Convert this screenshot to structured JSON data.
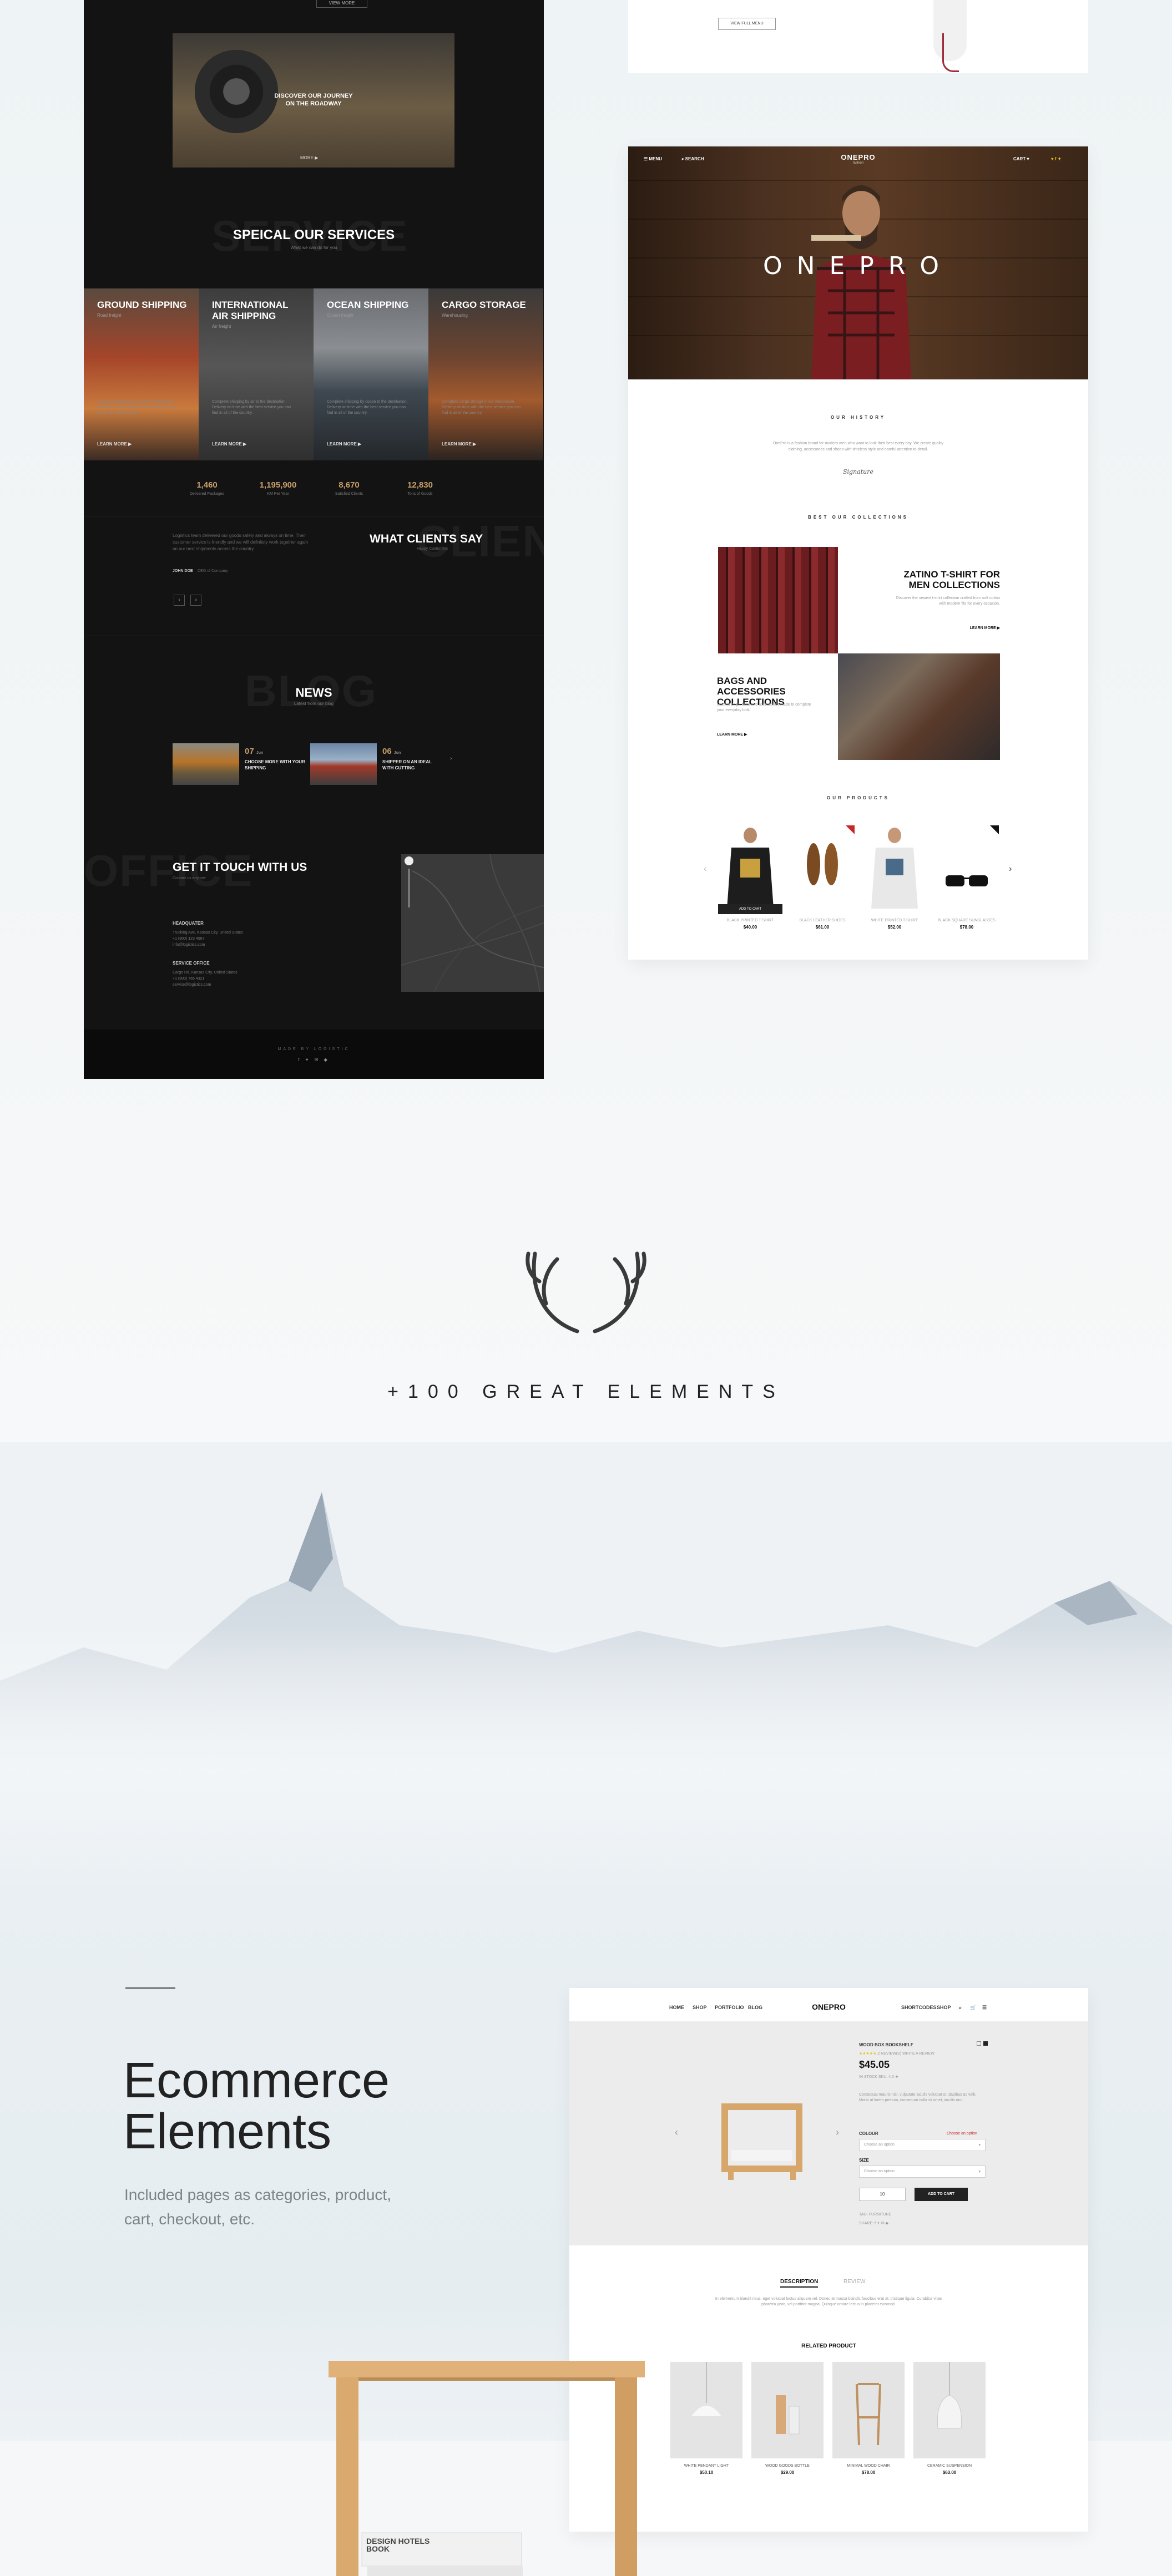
{
  "dark_page": {
    "top_button": "VIEW MORE",
    "hero": {
      "title": "DISCOVER OUR JOURNEY\nON THE ROADWAY",
      "more": "MORE ▶"
    },
    "services": {
      "ghost": "SERVICE",
      "title": "SPEICAL OUR SERVICES",
      "subtitle": "What we can do for you",
      "items": [
        {
          "title": "GROUND SHIPPING",
          "sub": "Road freight",
          "text": "Complete shipping by land to the destination. Delivery on time with the best service you can find in all of the country.",
          "more": "LEARN MORE ▶"
        },
        {
          "title": "INTERNATIONAL AIR SHIPPING",
          "sub": "Air freight",
          "text": "Complete shipping by air to the destination. Delivery on time with the best service you can find in all of the country.",
          "more": "LEARN MORE ▶"
        },
        {
          "title": "OCEAN SHIPPING",
          "sub": "Ocean freight",
          "text": "Complete shipping by ocean to the destination. Delivery on time with the best service you can find in all of the country.",
          "more": "LEARN MORE ▶"
        },
        {
          "title": "CARGO STORAGE",
          "sub": "Warehousing",
          "text": "Complete cargo storage in our warehouse. Delivery on time with the best service you can find in all of the country.",
          "more": "LEARN MORE ▶"
        }
      ]
    },
    "stats": [
      {
        "num": "1,460",
        "label": "Delivered Packages"
      },
      {
        "num": "1,195,900",
        "label": "KM Per Year"
      },
      {
        "num": "8,670",
        "label": "Satisfied Clients"
      },
      {
        "num": "12,830",
        "label": "Tons of Goods"
      }
    ],
    "clients": {
      "ghost": "CLIENT",
      "title": "WHAT CLIENTS SAY",
      "subtitle": "Happy Customers",
      "quote": "Logistics team delivered our goods safely and always on time. Their customer service is friendly and we will definitely work together again on our next shipments across the country.",
      "author": "JOHN DOE",
      "role": "CEO of Company",
      "prev": "‹",
      "next": "›"
    },
    "news": {
      "ghost": "BLOG",
      "title": "NEWS",
      "subtitle": "Latest from our blog",
      "items": [
        {
          "day": "07",
          "month": "Jun",
          "title": "CHOOSE MORE WITH YOUR SHIPPING"
        },
        {
          "day": "06",
          "month": "Jun",
          "title": "SHIPPER ON AN IDEAL WITH CUTTING"
        }
      ],
      "next": "›"
    },
    "contact": {
      "ghost": "OFFICE",
      "title": "GET IT TOUCH WITH US",
      "subtitle": "Contact us anytime",
      "hq_label": "HEADQUATER",
      "hq_text": "Trucking Ave, Kansas City, United States\n+1 (800) 123 4567\ninfo@logistics.com",
      "office_label": "SERVICE OFFICE",
      "office_text": "Cargo Rd, Kansas City, United States\n+1 (800) 765 4321\nservice@logistics.com"
    },
    "footer": {
      "made_by": "MADE BY LOGISTIC",
      "social": "f ✦ ✉ ◆"
    }
  },
  "vcard_top": {
    "button": "VIEW FULL MENU"
  },
  "onepro": {
    "nav_left": [
      "☰ MENU",
      "⌕ SEARCH"
    ],
    "logo": "ONEPRO",
    "logo_sub": "fashion",
    "nav_right": [
      "CART ▾",
      "♥  f  ✦"
    ],
    "hero_title": "ONEPRO",
    "history_h": "OUR HISTORY",
    "history_text": "OnePro is a fashion brand for modern men who want to look their best every day. We create quality clothing, accessories and shoes with timeless style and careful attention to detail.",
    "signature": "Signature",
    "collections_h": "BEST OUR COLLECTIONS",
    "col1_title": "ZATINO T-SHIRT FOR MEN COLLECTIONS",
    "col1_text": "Discover the newest t-shirt collection crafted from soft cotton with modern fits for every occasion.",
    "col1_link": "LEARN MORE ▶",
    "col2_title": "BAGS AND ACCESSORIES COLLECTIONS",
    "col2_text": "Leather bags, belts and accessories made to complete your everyday look.",
    "col2_link": "LEARN MORE ▶",
    "products_h": "OUR PRODUCTS",
    "add_to_cart": "ADD TO CART",
    "products": [
      {
        "name": "BLACK PRINTED T-SHIRT",
        "price": "$40.00"
      },
      {
        "name": "BLACK LEATHER SHOES",
        "price": "$61.00"
      },
      {
        "name": "WHITE PRINTED T-SHIRT",
        "price": "$52.00"
      },
      {
        "name": "BLACK SQUARE SUNGLASSES",
        "price": "$78.00"
      }
    ]
  },
  "tagline": "+100 GREAT ELEMENTS",
  "ecommerce": {
    "title_line1": "Ecommerce",
    "title_line2": "Elements",
    "subtitle": "Included pages as categories, product,\ncart, checkout, etc."
  },
  "shop": {
    "nav_left": [
      "HOME",
      "SHOP",
      "PORTFOLIO",
      "BLOG"
    ],
    "logo": "ONEPRO",
    "nav_right": [
      "SHORTCODES",
      "SHOP",
      "⌕",
      "🛒",
      "☰"
    ],
    "product_name": "WOOD BOX BOOKSHELF",
    "reviews": "2 REVIEW(S)   WRITE A REVIEW",
    "price": "$45.05",
    "availability": "IN STOCK   SKU: 4.0 ★",
    "description": "Consequat mauris nisl, vulputate iaculis volutpat ut, dapibus ac velit. Morbi ut lorem pretium, consequat nulla sit amet, iaculis orci.",
    "colour_label": "COLOUR",
    "colour_hint": "Choose an option",
    "colour_value": "Choose an option",
    "size_label": "SIZE",
    "size_value": "Choose an option",
    "qty": "10",
    "add_to_cart": "ADD TO CART",
    "tags": "TAG: FURNITURE",
    "share": "SHARE:  f  ✦  ✉  ◆",
    "tab_desc": "DESCRIPTION",
    "tab_review": "REVIEW",
    "desc_text": "In elementum blandit risus, eget volutpat lectus aliquam vel. Donec at massa blandit, faucibus erat at, tristique ligula. Curabitur vitae pharetra justo, vel porttitor magna. Quisque ornare lectus in placerat euismod.",
    "related_h": "RELATED PRODUCT",
    "related": [
      {
        "name": "WHITE PENDANT LIGHT",
        "price": "$50.10"
      },
      {
        "name": "WOOD GOODS BOTTLE",
        "price": "$29.00"
      },
      {
        "name": "MINIMAL WOOD CHAIR",
        "price": "$78.00"
      },
      {
        "name": "CERAMIC SUSPENSION",
        "price": "$63.00"
      }
    ]
  },
  "book": {
    "text": "DESIGN HOTELS\nBOOK"
  }
}
